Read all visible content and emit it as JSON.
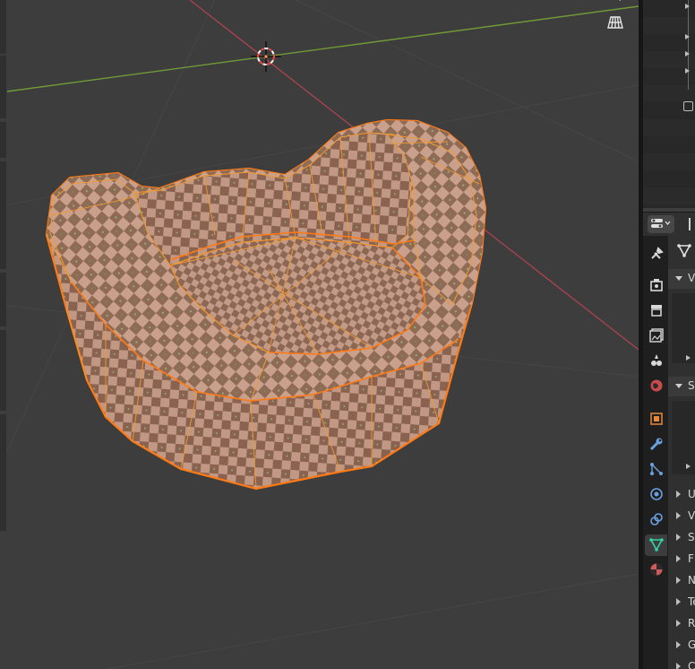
{
  "app": "Blender 3D Viewport",
  "viewport": {
    "gizmo_icons": [
      "camera-view-icon",
      "perspective-grid-icon"
    ]
  },
  "outliner": {
    "visible_rows": 12
  },
  "properties": {
    "tabs": [
      "tool",
      "render",
      "output",
      "view-layer",
      "scene",
      "world",
      "object",
      "modifiers",
      "particles",
      "physics",
      "constraints",
      "data",
      "material"
    ],
    "active_tab": "data",
    "sections": [
      {
        "label": "V",
        "expanded": true
      },
      {
        "label": "S",
        "expanded": true
      }
    ],
    "collapsed_panels": [
      "U",
      "V",
      "S",
      "F",
      "N",
      "Te",
      "R",
      "G",
      "C"
    ]
  },
  "colors": {
    "viewport_bg": "#3d3d3d",
    "x_axis": "#a3434f",
    "y_axis": "#6f9a37",
    "selection_outline": "#ff7a14",
    "edge": "#f29a32",
    "data_tab_active": "#2fd6a4"
  }
}
